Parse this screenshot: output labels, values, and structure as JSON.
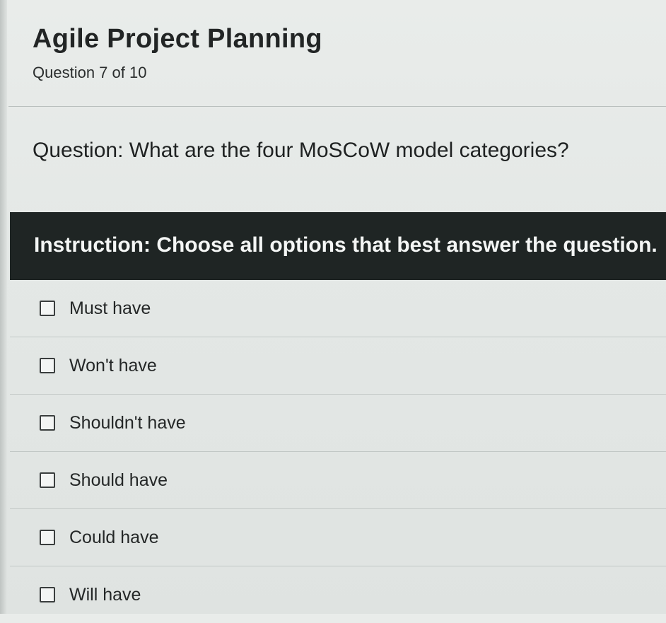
{
  "quiz": {
    "title": "Agile Project Planning",
    "progress": "Question 7 of 10",
    "question": "Question: What are the four MoSCoW model categories?",
    "instruction": "Instruction: Choose all options that best answer the question."
  },
  "options": [
    {
      "label": "Must have",
      "checked": false
    },
    {
      "label": "Won't have",
      "checked": false
    },
    {
      "label": "Shouldn't have",
      "checked": false
    },
    {
      "label": "Should have",
      "checked": false
    },
    {
      "label": "Could have",
      "checked": false
    },
    {
      "label": "Will have",
      "checked": false
    }
  ]
}
